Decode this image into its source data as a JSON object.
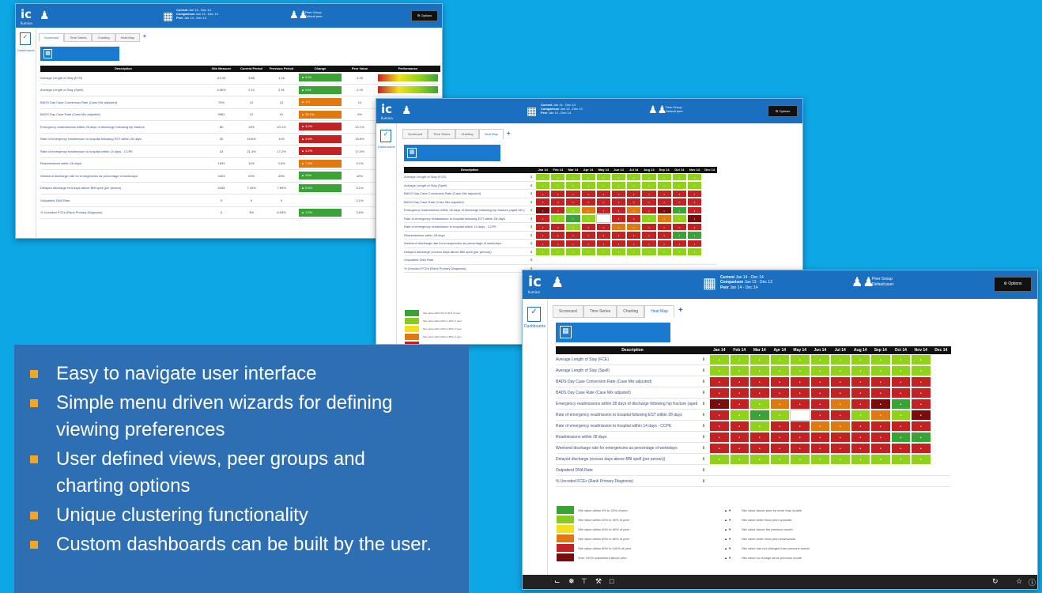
{
  "app": {
    "logo": "ic",
    "logo_sub": "Ilumina",
    "dates": {
      "current_label": "Current",
      "comparison_label": "Comparison",
      "peer_label": "Peer",
      "current_value": "Jan 14 - Dec 14",
      "comparison_value": "Jan 13 - Dec 13",
      "peer_value": "Jan 14 - Dec 14"
    },
    "peer_group": {
      "title": "Peer Group",
      "value": "Default peer"
    },
    "options_label": "Options",
    "sidebar_label": "Dashboards",
    "tabs": [
      "Scorecard",
      "Time Series",
      "Charting",
      "Heat Map"
    ],
    "description_header": "Description"
  },
  "scorecard": {
    "columns": [
      "Description",
      "Site Measure",
      "Current Period",
      "Previous Period",
      "Change",
      "Peer Value",
      "Performance"
    ],
    "rows": [
      {
        "desc": "Average Length of Stay (ETS)",
        "v1": "21.02",
        "v2": "3.85",
        "v3": "1.15",
        "change": "0.93",
        "peer": "3.15",
        "status": "green"
      },
      {
        "desc": "Average Length of Stay (Spell)",
        "v1": "3.96%",
        "v2": "2.10",
        "v3": "2.91",
        "change": "0.81",
        "peer": "2.15",
        "status": "green"
      },
      {
        "desc": "BADS Day Case Conversion Rate (Case Mix adjusted)",
        "v1": "74%",
        "v2": "12",
        "v3": "13",
        "change": "1.0",
        "peer": "14",
        "status": "orange"
      },
      {
        "desc": "BADS Day Case Rate (Case Mix adjusted)",
        "v1": "9981",
        "v2": "12",
        "v3": "91",
        "change": "19.1%",
        "peer": "9%",
        "status": "orange"
      },
      {
        "desc": "Emergency readmissions within 28 days of discharge following hip fracture",
        "v1": "60",
        "v2": "13%",
        "v3": "10.1%",
        "change": "3.0%",
        "peer": "10.1%",
        "status": "red"
      },
      {
        "desc": "Rate of emergency readmission to hospital following EST within 28 days",
        "v1": "30",
        "v2": "15.6%",
        "v3": "11%",
        "change": "4.6%",
        "peer": "15.6%",
        "status": "red"
      },
      {
        "desc": "Rate of emergency readmission to hospital within 14 days - CCPE",
        "v1": "33",
        "v2": "21.4%",
        "v3": "17.2%",
        "change": "4.2%",
        "peer": "17.0%",
        "status": "red"
      },
      {
        "desc": "Readmissions within 28 days",
        "v1": "1693",
        "v2": "11%",
        "v3": "3.6%",
        "change": "7.3%",
        "peer": "9.1%",
        "status": "orange"
      },
      {
        "desc": "Weekend discharge rate for emergencies as percentage of weekdays",
        "v1": "4403",
        "v2": "22%",
        "v3": "43%",
        "change": "20%",
        "peer": "42%",
        "status": "green"
      },
      {
        "desc": "Delayed discharge bed days above BBI spell (per person)",
        "v1": "5335",
        "v2": "7.25%",
        "v3": "7.89%",
        "change": "0.6%",
        "peer": "8.1%",
        "status": "green"
      },
      {
        "desc": "Outpatient DNA Rate",
        "v1": "0",
        "v2": "0",
        "v3": "0",
        "change": "",
        "peer": "2.1%",
        "status": "none"
      },
      {
        "desc": "% Uncoded FCEs (Rank Primary Diagnosis)",
        "v1": "0",
        "v2": "3%",
        "v3": "6.05%",
        "change": "1.5%",
        "peer": "3.6%",
        "status": "green"
      }
    ]
  },
  "heatmap": {
    "months": [
      "Jan 14",
      "Feb 14",
      "Mar 14",
      "Apr 14",
      "May 14",
      "Jun 14",
      "Jul 14",
      "Aug 14",
      "Sep 14",
      "Oct 14",
      "Nov 14",
      "Dec 14"
    ],
    "rows": [
      {
        "desc": "Average Length of Stay (FCE)",
        "cells": [
          "lg",
          "lg",
          "lg",
          "lg",
          "lg",
          "lg",
          "lg",
          "lg",
          "lg",
          "lg",
          "lg",
          "--"
        ]
      },
      {
        "desc": "Average Length of Stay (Spell)",
        "cells": [
          "lg",
          "lg",
          "lg",
          "lg",
          "lg",
          "lg",
          "lg",
          "lg",
          "lg",
          "lg",
          "lg",
          "--"
        ]
      },
      {
        "desc": "BADS Day Case Conversion Rate (Case Mix adjusted)",
        "cells": [
          "rd",
          "rd",
          "rd",
          "rd",
          "rd",
          "rd",
          "rd",
          "rd",
          "rd",
          "rd",
          "rd",
          "--"
        ]
      },
      {
        "desc": "BADS Day Case Rate (Case Mix adjusted)",
        "cells": [
          "rd",
          "rd",
          "rd",
          "rd",
          "rd",
          "rd",
          "rd",
          "rd",
          "rd",
          "rd",
          "rd",
          "--"
        ]
      },
      {
        "desc": "Emergency readmissions within 28 days of discharge following hip fracture (aged 65+)",
        "cells": [
          "dr",
          "rd",
          "lg",
          "og",
          "rd",
          "rd",
          "og",
          "rd",
          "dr",
          "gr",
          "rd",
          "--"
        ]
      },
      {
        "desc": "Rate of emergency readmission to hospital following EST within 28 days",
        "cells": [
          "rd",
          "lg",
          "gr",
          "lg",
          "wh",
          "rd",
          "rd",
          "lg",
          "og",
          "lg",
          "dr",
          "--"
        ]
      },
      {
        "desc": "Rate of emergency readmission to hospital within 14 days - CCPE",
        "cells": [
          "rd",
          "rd",
          "lg",
          "rd",
          "rd",
          "og",
          "og",
          "rd",
          "rd",
          "rd",
          "rd",
          "--"
        ]
      },
      {
        "desc": "Readmissions within 28 days",
        "cells": [
          "rd",
          "rd",
          "rd",
          "rd",
          "rd",
          "rd",
          "rd",
          "rd",
          "rd",
          "gr",
          "gr",
          "--"
        ]
      },
      {
        "desc": "Weekend discharge rate for emergencies as percentage of weekdays",
        "cells": [
          "rd",
          "rd",
          "rd",
          "rd",
          "rd",
          "rd",
          "rd",
          "rd",
          "rd",
          "rd",
          "rd",
          "--"
        ]
      },
      {
        "desc": "Delayed discharge (excess days above BBI spell (per person))",
        "cells": [
          "lg",
          "lg",
          "lg",
          "lg",
          "lg",
          "lg",
          "lg",
          "lg",
          "lg",
          "lg",
          "lg",
          "--"
        ]
      },
      {
        "desc": "Outpatient DNA Rate",
        "cells": []
      },
      {
        "desc": "% Uncoded FCEs (Rank Primary Diagnosis)",
        "cells": []
      }
    ],
    "legend_left": [
      {
        "color": "#3aa335",
        "text": "Site value within 0% to 20% of peer"
      },
      {
        "color": "#88cc22",
        "text": "Site value within 20% to 40% of peer"
      },
      {
        "color": "#f2e11a",
        "text": "Site value within 40% to 60% of peer"
      },
      {
        "color": "#e07a10",
        "text": "Site value within 60% to 80% of peer"
      },
      {
        "color": "#c42222",
        "text": "Site value within 80% to 100% of peer"
      },
      {
        "color": "#7a0c0c",
        "text": "Over 100% adjustment above peer"
      }
    ],
    "legend_right": [
      "Site value above peer by more than double",
      "Site value better than peer upwards",
      "Site value above the previous month",
      "Site value better than peer downwards",
      "Site value has not changed from previous month",
      "Site value no change since previous month"
    ]
  },
  "features": [
    "Easy to navigate user interface",
    "Simple menu driven wizards for defining viewing preferences",
    "User defined views, peer groups and charting options",
    "Unique clustering functionality",
    "Custom dashboards can be built by the user."
  ],
  "colors": {
    "background": "#0ea7e6",
    "header": "#1a6fc0",
    "feature_box": "#2e6fb4",
    "bullet": "#f5a524",
    "lg": "#8fd11b",
    "gr": "#3aa335",
    "rd": "#c42222",
    "dr": "#7a0c0c",
    "og": "#e07a10",
    "wh": "#ffffff"
  }
}
